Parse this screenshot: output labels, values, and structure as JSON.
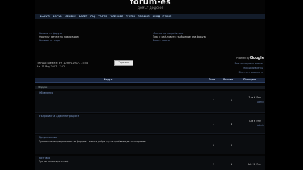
{
  "header": {
    "logo": "forum-es",
    "tagline": "ДОМЪТ ДОДОЮЯ"
  },
  "nav": {
    "items": [
      "ФАКУЛ",
      "ФОРУМ",
      "СЕЛЕНЕ",
      "БАЛЕТ",
      "FAQ",
      "ТЪРСИ",
      "ЧЛЕНОВЕ",
      "ГРУПИ",
      "ПРОФИЛ",
      "ВХОД",
      "РЕГИС"
    ]
  },
  "announcements": {
    "left_title": "Новини от форума",
    "left_line1": "Форумът вече е на новия адрес",
    "left_line2": "Напишете нещо",
    "right_title": "Мнения на потребители",
    "right_line1": "Това е най-новото съобщение във форума",
    "right_line2": "Вижте повече"
  },
  "search": {
    "brand_prefix": "Powered by",
    "brand_name": "Google"
  },
  "timeline": {
    "line1": "Текущо време е: Вт, 10 Яну 2007 - 23:58",
    "line2": "Вт, 11 Яну 2007 - 7:52",
    "goto_button": "Търсене"
  },
  "right_links": [
    "Виж последните мнения",
    "Маркирай всички",
    "Виж неотговорените"
  ],
  "table": {
    "col_forum": "Форум",
    "col_topics": "Теми",
    "col_posts": "Мнения",
    "col_last": "Последно",
    "category": "Форуми",
    "rows": [
      {
        "title": "Обявления",
        "desc": "",
        "topics": "1",
        "posts": "1",
        "date": "Tue 6 Яну",
        "by": "Admin"
      },
      {
        "title": "Въпроси към администрацията",
        "desc": "",
        "topics": "1",
        "posts": "1",
        "date": "Tue 6 Яну",
        "by": "Admin"
      },
      {
        "title": "Предложения",
        "desc": "Тука пишете предложения за форума... ако са добри ще се пробваме да ги направим",
        "topics": "0",
        "posts": "0",
        "date": "",
        "by": ""
      },
      {
        "title": "Разговор",
        "desc": "Тук се разговаря с шеф",
        "topics": "1",
        "posts": "1",
        "date": "Sat 28 Яну",
        "by": "Admin"
      }
    ]
  }
}
